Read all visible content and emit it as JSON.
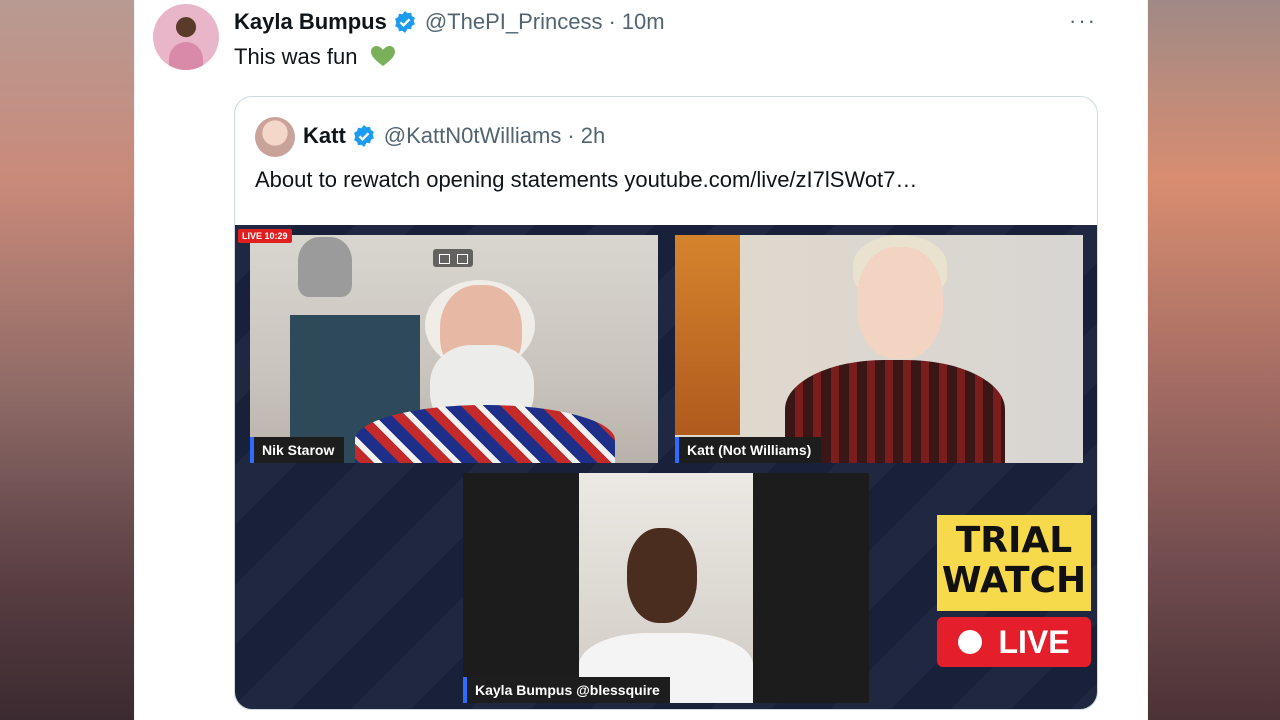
{
  "tweet": {
    "author_name": "Kayla Bumpus",
    "handle": "@ThePI_Princess",
    "separator": "·",
    "time": "10m",
    "more_label": "···",
    "text": "This was fun",
    "emoji_icon": "green-heart-icon"
  },
  "quoted": {
    "author_name": "Katt",
    "handle": "@KattN0tWilliams",
    "separator": "·",
    "time": "2h",
    "text": "About to rewatch opening statements youtube.com/live/zI7lSWot7…"
  },
  "video": {
    "live_timer": "LIVE 10:29",
    "participants": [
      {
        "name": "Nik Starow"
      },
      {
        "name": "Katt (Not Williams)"
      },
      {
        "name": "Kayla Bumpus @blessquire"
      }
    ],
    "overlay_title_line1": "TRIAL",
    "overlay_title_line2": "WATCH",
    "live_badge": "LIVE"
  },
  "colors": {
    "verified": "#1d9bf0",
    "live_red": "#e41e2b",
    "trial_yellow": "#f7d94c",
    "namebar_accent": "#2f6bff"
  }
}
